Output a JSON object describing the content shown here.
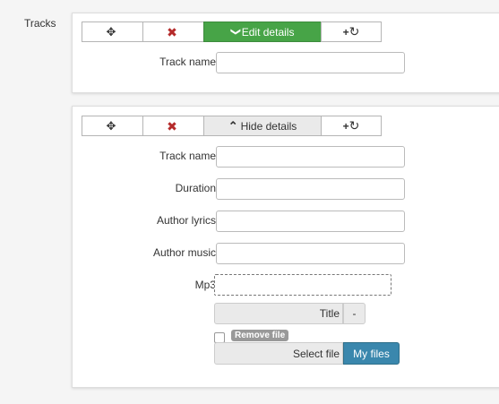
{
  "section": {
    "label": "Tracks"
  },
  "track1": {
    "toolbar": {
      "move_icon": "✥",
      "delete_icon": "✖",
      "toggle_icon": "❯",
      "toggle_label": "Edit details",
      "add_label": "+",
      "add_icon": "↻"
    },
    "fields": [
      {
        "label": "Track name",
        "value": ""
      }
    ]
  },
  "track2": {
    "toolbar": {
      "move_icon": "✥",
      "delete_icon": "✖",
      "toggle_icon": "⌃",
      "toggle_label": "Hide details",
      "add_label": "+",
      "add_icon": "↻"
    },
    "fields": [
      {
        "label": "Track name",
        "value": ""
      },
      {
        "label": "Duration",
        "value": ""
      },
      {
        "label": "Author lyrics",
        "value": ""
      },
      {
        "label": "Author music",
        "value": ""
      }
    ],
    "mp3": {
      "label": "Mp3",
      "title_label": "Title",
      "dash_label": "-",
      "remove_label": "Remove file",
      "select_label": "Select file",
      "myfiles_label": "My files"
    }
  },
  "colors": {
    "edit_green": "#47a447",
    "delete_red": "#b52a2a",
    "myfiles_blue": "#3a87ad"
  }
}
